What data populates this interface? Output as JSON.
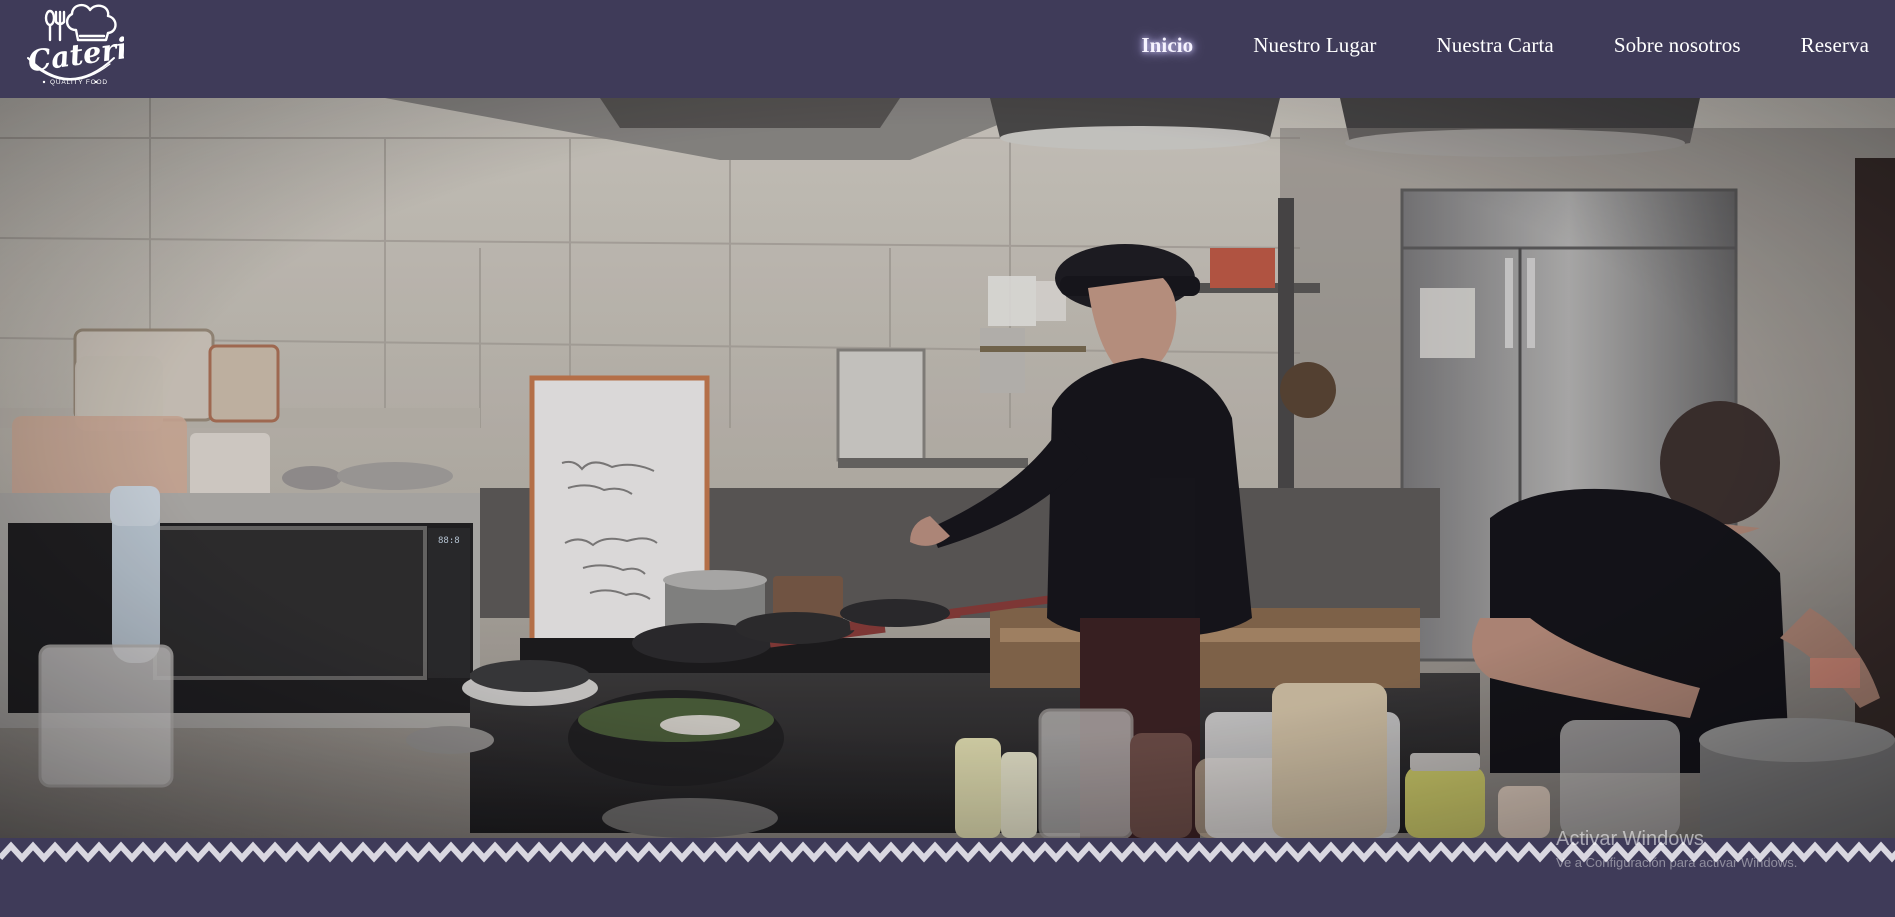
{
  "header": {
    "logo": {
      "text": "Catering",
      "tagline": "QUALITY FOOD",
      "icon": "chef-hat-icon"
    },
    "nav": [
      {
        "label": "Inicio",
        "active": true
      },
      {
        "label": "Nuestro Lugar",
        "active": false
      },
      {
        "label": "Nuestra Carta",
        "active": false
      },
      {
        "label": "Sobre nosotros",
        "active": false
      },
      {
        "label": "Reserva",
        "active": false
      }
    ]
  },
  "hero": {
    "image": "restaurant-kitchen-photo",
    "description_icon": "photo"
  },
  "watermark": {
    "title": "Activar Windows",
    "subtitle": "Ve a Configuración para activar Windows."
  },
  "colors": {
    "header_bg": "#3f3b59",
    "nav_text": "#ffffff",
    "zigzag": "#d9d7e0"
  }
}
